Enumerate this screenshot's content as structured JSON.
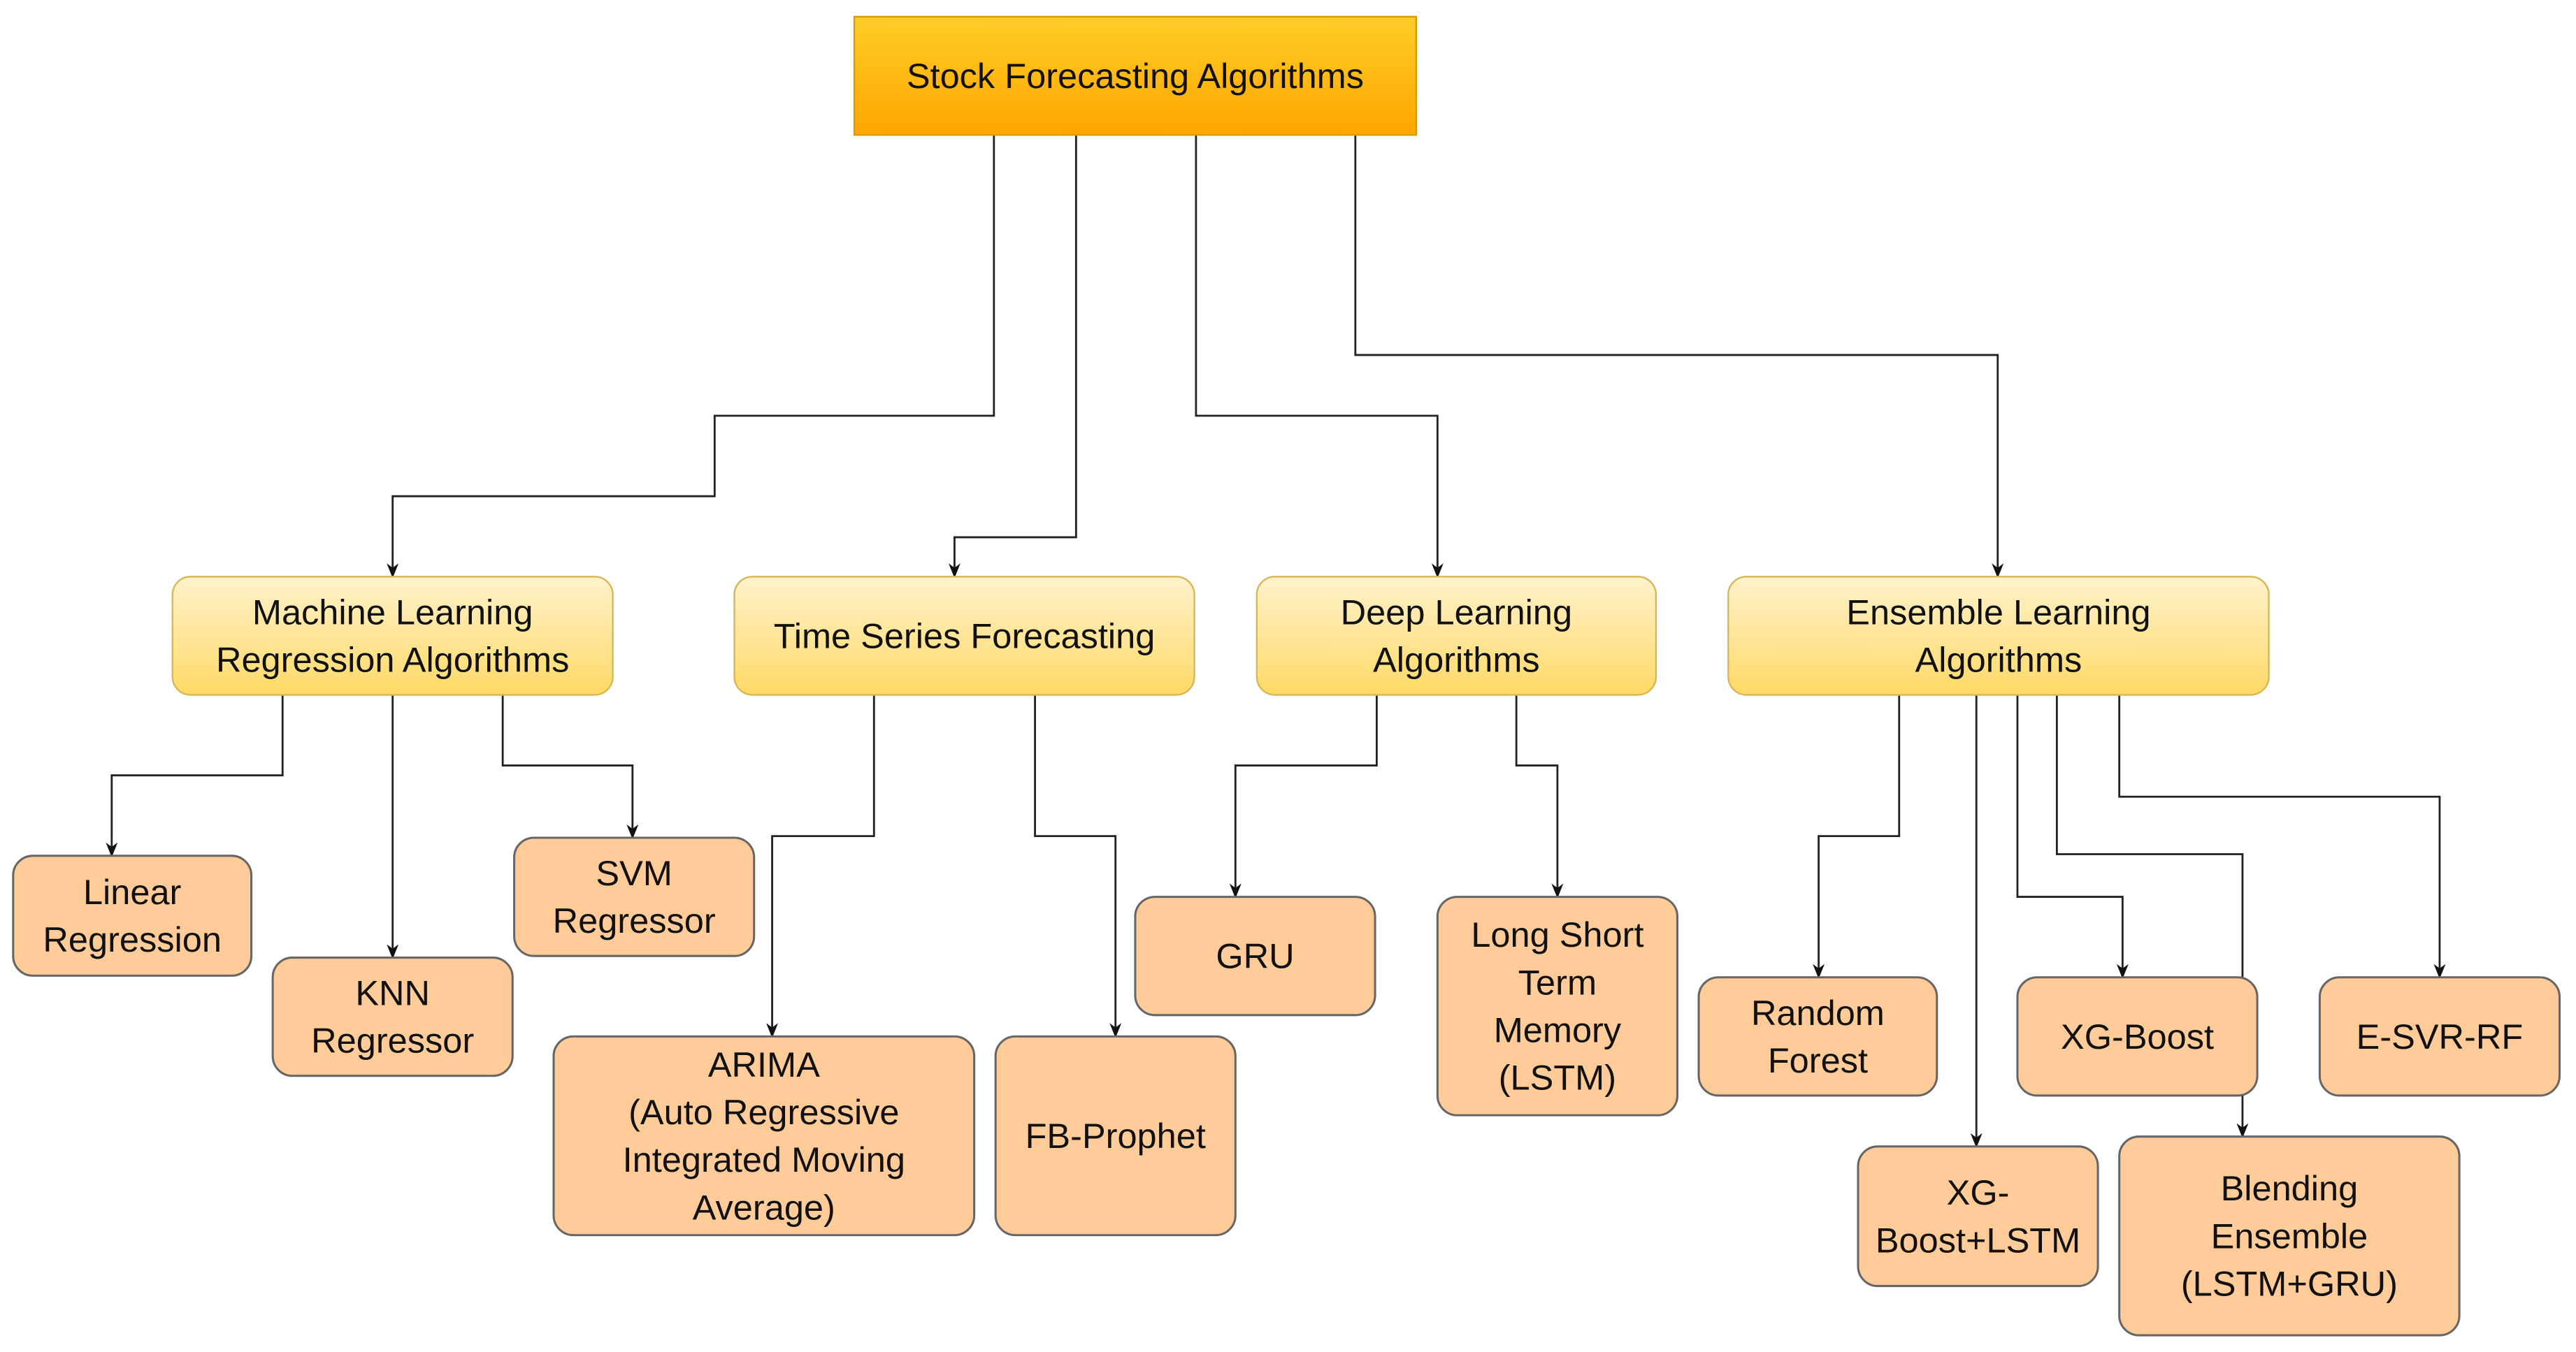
{
  "diagram": {
    "root": {
      "id": "root",
      "lines": [
        "Stock Forecasting Algorithms"
      ]
    },
    "categories": [
      {
        "id": "ml",
        "lines": [
          "Machine Learning",
          "Regression Algorithms"
        ]
      },
      {
        "id": "ts",
        "lines": [
          "Time Series Forecasting"
        ]
      },
      {
        "id": "dl",
        "lines": [
          "Deep Learning",
          "Algorithms"
        ]
      },
      {
        "id": "ens",
        "lines": [
          "Ensemble Learning",
          "Algorithms"
        ]
      }
    ],
    "leaves": [
      {
        "id": "linreg",
        "parent": "ml",
        "lines": [
          "Linear",
          "Regression"
        ]
      },
      {
        "id": "knn",
        "parent": "ml",
        "lines": [
          "KNN",
          "Regressor"
        ]
      },
      {
        "id": "svm",
        "parent": "ml",
        "lines": [
          "SVM",
          "Regressor"
        ]
      },
      {
        "id": "arima",
        "parent": "ts",
        "lines": [
          "ARIMA",
          "(Auto Regressive",
          "Integrated Moving",
          "Average)"
        ]
      },
      {
        "id": "prophet",
        "parent": "ts",
        "lines": [
          "FB-Prophet"
        ]
      },
      {
        "id": "gru",
        "parent": "dl",
        "lines": [
          "GRU"
        ]
      },
      {
        "id": "lstm",
        "parent": "dl",
        "lines": [
          "Long Short",
          "Term",
          "Memory",
          "(LSTM)"
        ]
      },
      {
        "id": "rf",
        "parent": "ens",
        "lines": [
          "Random",
          "Forest"
        ]
      },
      {
        "id": "xgblstm",
        "parent": "ens",
        "lines": [
          "XG-",
          "Boost+LSTM"
        ]
      },
      {
        "id": "xgb",
        "parent": "ens",
        "lines": [
          "XG-Boost"
        ]
      },
      {
        "id": "blend",
        "parent": "ens",
        "lines": [
          "Blending",
          "Ensemble",
          "(LSTM+GRU)"
        ]
      },
      {
        "id": "esvr",
        "parent": "ens",
        "lines": [
          "E-SVR-RF"
        ]
      }
    ],
    "colors": {
      "root_top": "#ffcd28",
      "root_bottom": "#ffa500",
      "root_border": "#d79b00",
      "category_top": "#fff2cc",
      "category_bottom": "#ffd966",
      "category_border": "#d6b656",
      "leaf_fill": "#ffcc99",
      "leaf_border": "#666666",
      "edge": "#222222"
    }
  }
}
